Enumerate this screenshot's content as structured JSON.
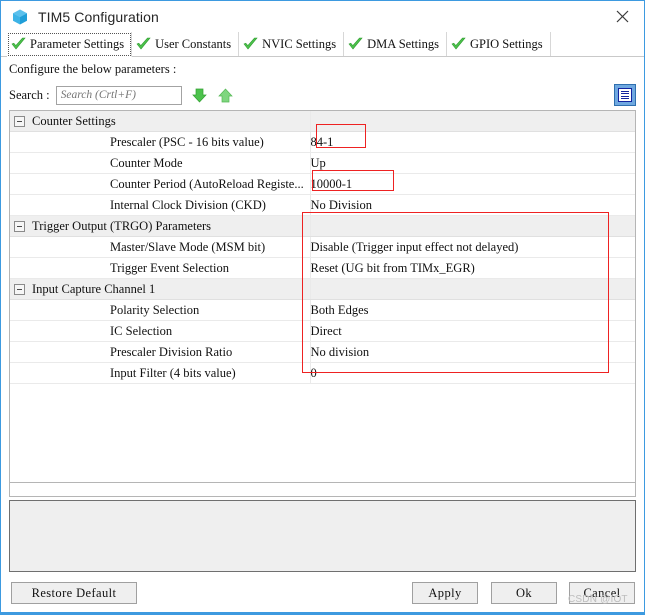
{
  "window": {
    "title": "TIM5 Configuration",
    "icon": "cube-icon",
    "close_icon": "close-icon"
  },
  "tabs": [
    {
      "label": "Parameter Settings",
      "icon": "green-check-icon",
      "active": true
    },
    {
      "label": "User Constants",
      "icon": "green-check-icon",
      "active": false
    },
    {
      "label": "NVIC Settings",
      "icon": "green-check-icon",
      "active": false
    },
    {
      "label": "DMA Settings",
      "icon": "green-check-icon",
      "active": false
    },
    {
      "label": "GPIO Settings",
      "icon": "green-check-icon",
      "active": false
    }
  ],
  "instruction": "Configure the below parameters :",
  "search": {
    "label": "Search :",
    "value": "",
    "placeholder": "Search (Crtl+F)",
    "next_icon": "arrow-down-icon",
    "prev_icon": "arrow-up-icon"
  },
  "view_toggle": {
    "icon": "list-view-icon",
    "active": true
  },
  "groups": [
    {
      "title": "Counter Settings",
      "expanded": true,
      "rows": [
        {
          "name": "Prescaler (PSC - 16 bits value)",
          "value": "84-1"
        },
        {
          "name": "Counter Mode",
          "value": "Up"
        },
        {
          "name": "Counter Period (AutoReload Registe...",
          "value": "10000-1"
        },
        {
          "name": "Internal Clock Division (CKD)",
          "value": "No Division"
        }
      ]
    },
    {
      "title": "Trigger Output (TRGO) Parameters",
      "expanded": true,
      "rows": [
        {
          "name": "Master/Slave Mode (MSM bit)",
          "value": "Disable (Trigger input effect not delayed)"
        },
        {
          "name": "Trigger Event Selection",
          "value": "Reset (UG bit from TIMx_EGR)"
        }
      ]
    },
    {
      "title": "Input Capture Channel 1",
      "expanded": true,
      "rows": [
        {
          "name": "Polarity Selection",
          "value": "Both Edges"
        },
        {
          "name": "IC Selection",
          "value": "Direct"
        },
        {
          "name": "Prescaler Division Ratio",
          "value": "No division"
        },
        {
          "name": "Input Filter (4 bits value)",
          "value": "0"
        }
      ]
    }
  ],
  "annotations": {
    "color": "#ee2222",
    "boxes": [
      {
        "name": "prescaler-value-highlight",
        "target": "84-1"
      },
      {
        "name": "counter-period-value-highlight",
        "target": "10000-1"
      },
      {
        "name": "trigger-and-capture-values-highlight",
        "target": "Trigger Output (TRGO) Parameters / Input Capture Channel 1 values"
      }
    ]
  },
  "buttons": {
    "restore_default": "Restore Default",
    "apply": "Apply",
    "ok": "Ok",
    "cancel": "Cancel"
  },
  "watermark": "CSDN @IOT",
  "colors": {
    "window_border": "#3d9ae0",
    "group_row": "#efefef",
    "accent_blue": "#00a8e8",
    "annotation_red": "#ee2222",
    "toggle_blue": "#6fa8e0"
  }
}
